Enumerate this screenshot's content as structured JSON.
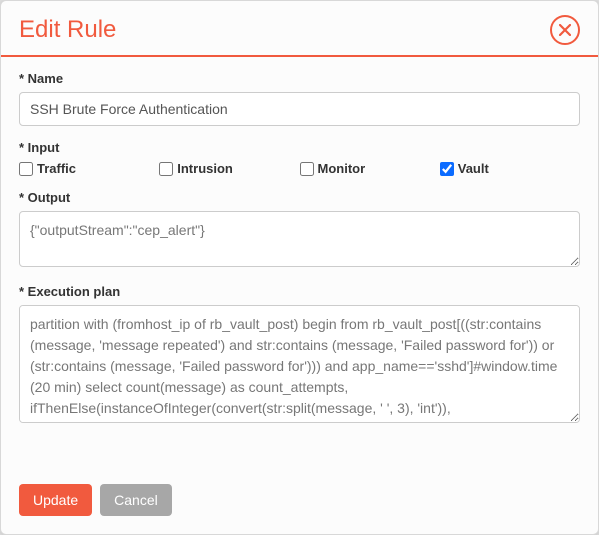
{
  "header": {
    "title": "Edit Rule"
  },
  "form": {
    "name_label": "* Name",
    "name_value": "SSH Brute Force Authentication",
    "input_label": "* Input",
    "input_options": [
      {
        "label": "Traffic",
        "checked": false
      },
      {
        "label": "Intrusion",
        "checked": false
      },
      {
        "label": "Monitor",
        "checked": false
      },
      {
        "label": "Vault",
        "checked": true
      }
    ],
    "output_label": "* Output",
    "output_value": "{\"outputStream\":\"cep_alert\"}",
    "exec_label": "* Execution plan",
    "exec_value": "partition with (fromhost_ip of rb_vault_post) begin from rb_vault_post[((str:contains (message, 'message repeated') and str:contains (message, 'Failed password for')) or (str:contains (message, 'Failed password for'))) and app_name=='sshd']#window.time (20 min) select count(message) as count_attempts, ifThenElse(instanceOfInteger(convert(str:split(message, ' ', 3), 'int')),"
  },
  "footer": {
    "update_label": "Update",
    "cancel_label": "Cancel"
  }
}
